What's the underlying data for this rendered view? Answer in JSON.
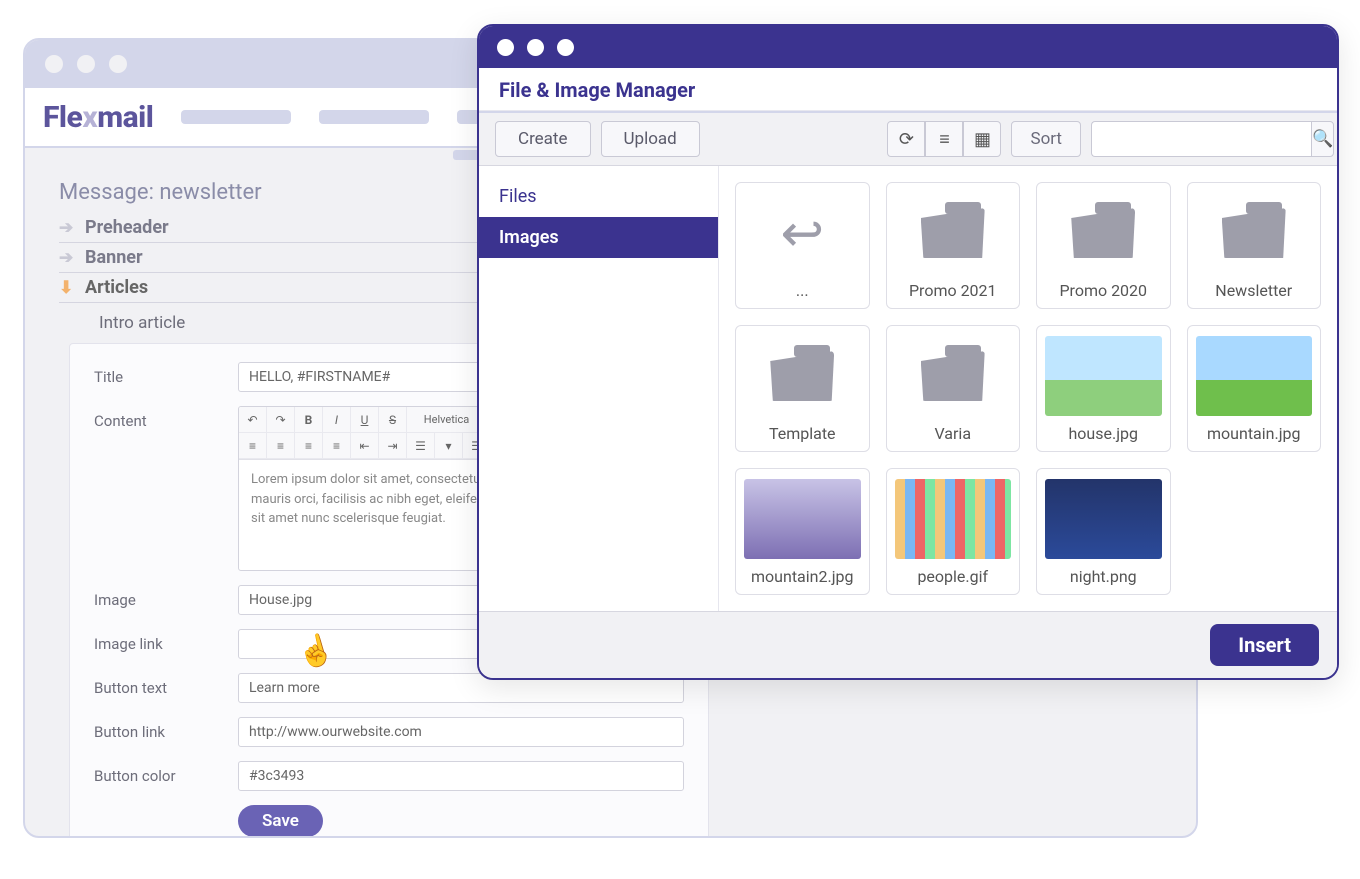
{
  "app": {
    "name": "Flexmail",
    "name_a": "Fle",
    "name_x": "x",
    "name_b": "mail"
  },
  "editor": {
    "message_title": "Message: newsletter",
    "nav": {
      "preheader": "Preheader",
      "banner": "Banner",
      "articles": "Articles"
    },
    "section_label": "Intro article",
    "labels": {
      "title": "Title",
      "content": "Content",
      "image": "Image",
      "image_link": "Image link",
      "button_text": "Button text",
      "button_link": "Button link",
      "button_color": "Button color"
    },
    "values": {
      "title": "HELLO, #FIRSTNAME#",
      "image": "House.jpg",
      "image_link": "",
      "button_text": "Learn more",
      "button_link": "http://www.ourwebsite.com",
      "button_color": "#3c3493",
      "font": "Helvetica",
      "content": "Lorem ipsum dolor sit amet, consectetur adipiscing elit. Aenean a mauris orci, facilisis ac nibh eget, eleifend pulvinar augue. Nam vulputate sit amet nunc scelerisque feugiat."
    },
    "save": "Save"
  },
  "fm": {
    "title": "File & Image Manager",
    "buttons": {
      "create": "Create",
      "upload": "Upload",
      "sort": "Sort",
      "insert": "Insert"
    },
    "tabs": {
      "files": "Files",
      "images": "Images"
    },
    "search_placeholder": "",
    "items": {
      "back": "...",
      "promo2021": "Promo 2021",
      "promo2020": "Promo 2020",
      "newsletter": "Newsletter",
      "template": "Template",
      "varia": "Varia",
      "house": "house.jpg",
      "mountain": "mountain.jpg",
      "mountain2": "mountain2.jpg",
      "people": "people.gif",
      "night": "night.png"
    }
  }
}
